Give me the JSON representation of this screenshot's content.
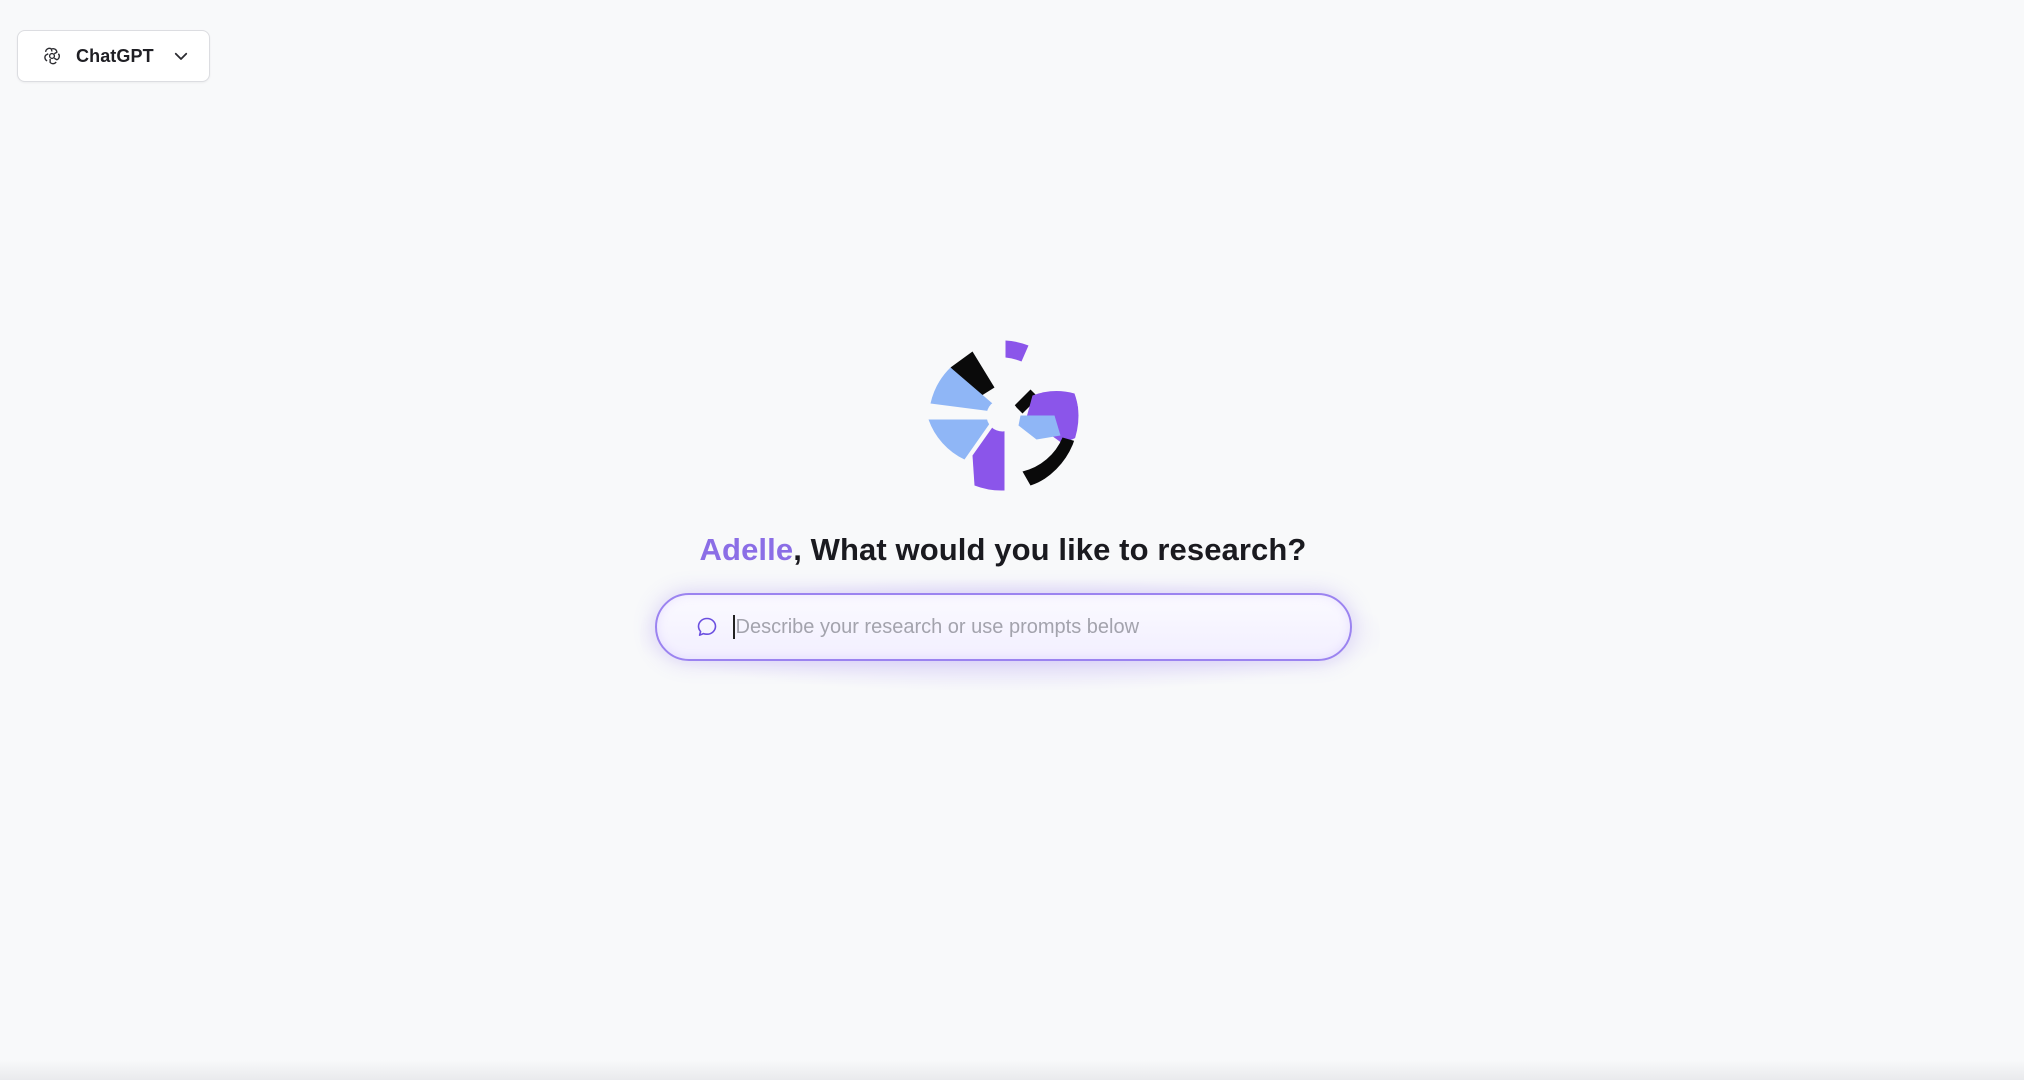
{
  "model_selector": {
    "icon": "openai-icon",
    "label": "ChatGPT",
    "chevron": "chevron-down-icon"
  },
  "hero": {
    "logo": "brand-logo",
    "user_name": "Adelle",
    "question": ", What would you like to research?"
  },
  "search": {
    "icon": "chat-bubble-icon",
    "placeholder": "Describe your research or use prompts below",
    "value": ""
  },
  "colors": {
    "accent": "#8b6ee6",
    "logo_purple": "#8b55ea",
    "logo_blue": "#8fb6f6",
    "logo_black": "#0a0a0a",
    "background": "#f8f9fa"
  }
}
